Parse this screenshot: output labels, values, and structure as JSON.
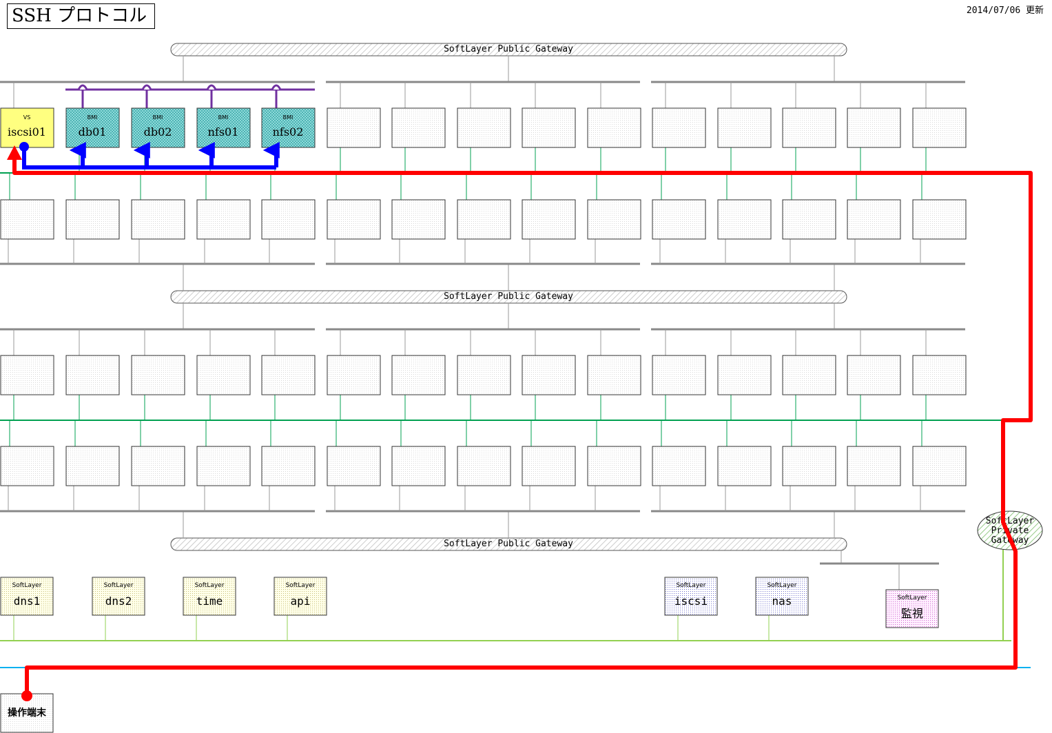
{
  "title": "SSH プロトコル",
  "updated": "2014/07/06 更新",
  "gateways": {
    "public_label": "SoftLayer Public Gateway",
    "private_label_lines": [
      "SoftLayer",
      "Private",
      "Gateway"
    ]
  },
  "servers": [
    {
      "sub": "VS",
      "name": "iscsi01",
      "kind": "vs"
    },
    {
      "sub": "BMI",
      "name": "db01",
      "kind": "bmi"
    },
    {
      "sub": "BMI",
      "name": "db02",
      "kind": "bmi"
    },
    {
      "sub": "BMI",
      "name": "nfs01",
      "kind": "bmi"
    },
    {
      "sub": "BMI",
      "name": "nfs02",
      "kind": "bmi"
    }
  ],
  "services": [
    {
      "sub": "SoftLayer",
      "name": "dns1",
      "kind": "yellow"
    },
    {
      "sub": "SoftLayer",
      "name": "dns2",
      "kind": "yellow"
    },
    {
      "sub": "SoftLayer",
      "name": "time",
      "kind": "yellow"
    },
    {
      "sub": "SoftLayer",
      "name": "api",
      "kind": "yellow"
    },
    {
      "sub": "SoftLayer",
      "name": "iscsi",
      "kind": "blue"
    },
    {
      "sub": "SoftLayer",
      "name": "nas",
      "kind": "blue"
    },
    {
      "sub": "SoftLayer",
      "name": "監視",
      "kind": "pink"
    }
  ],
  "terminal": {
    "label": "操作端末"
  },
  "colors": {
    "ssh_path": "#ff0000",
    "internal_path": "#0000ff",
    "private_vlan": "#00a050",
    "public_vlan": "#888888",
    "bmi_link": "#7030a0",
    "service_net": "#92d050",
    "client_net": "#00b0f0",
    "vs_fill": "#ffff80",
    "bmi_fill": "#66cccc"
  }
}
